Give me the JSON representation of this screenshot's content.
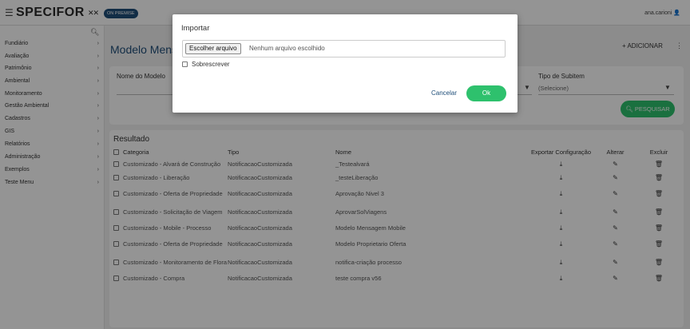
{
  "header": {
    "logo": "SPECIFOR",
    "logo_dots": "✕✕",
    "badge": "ON PREMISE",
    "user": "ana.carioni",
    "menu_icon": "hamburger-icon",
    "user_icon": "user-icon"
  },
  "sidebar": {
    "items": [
      {
        "label": "Fundiário"
      },
      {
        "label": "Avaliação"
      },
      {
        "label": "Patrimônio"
      },
      {
        "label": "Ambiental"
      },
      {
        "label": "Monitoramento"
      },
      {
        "label": "Gestão Ambiental"
      },
      {
        "label": "Cadastros"
      },
      {
        "label": "GIS"
      },
      {
        "label": "Relatórios"
      },
      {
        "label": "Administração"
      },
      {
        "label": "Exemplos"
      },
      {
        "label": "Teste Menu"
      }
    ]
  },
  "main": {
    "title": "Modelo Mensa",
    "add_label": "+ ADICIONAR",
    "filters": {
      "nome_label": "Nome do Modelo",
      "tipo_sub_label": "Tipo de Subitem",
      "tipo_sub_value": "(Selecione)",
      "search_label": "PESQUISAR"
    },
    "results": {
      "title": "Resultado",
      "headers": {
        "categoria": "Categoria",
        "tipo": "Tipo",
        "nome": "Nome",
        "exportar": "Exportar Configuração",
        "alterar": "Alterar",
        "excluir": "Excluir"
      },
      "rows": [
        {
          "categoria": "Customizado - Alvará de Construção",
          "tipo": "NotificacaoCustomizada",
          "nome": "_Testealvará"
        },
        {
          "categoria": "Customizado - Liberação",
          "tipo": "NotificacaoCustomizada",
          "nome": "_testeLiberação"
        },
        {
          "categoria": "Customizado - Oferta de Propriedade",
          "tipo": "NotificacaoCustomizada",
          "nome": "Aprovação Nivel 3"
        },
        {
          "categoria": "Customizado - Solicitação de Viagem",
          "tipo": "NotificacaoCustomizada",
          "nome": "AprovarSolViagens"
        },
        {
          "categoria": "Customizado - Mobile - Processo",
          "tipo": "NotificacaoCustomizada",
          "nome": "Modelo Mensagem Mobile"
        },
        {
          "categoria": "Customizado - Oferta de Propriedade",
          "tipo": "NotificacaoCustomizada",
          "nome": "Modelo Proprietario Oferta"
        },
        {
          "categoria": "Customizado - Monitoramento de Flora",
          "tipo": "NotificacaoCustomizada",
          "nome": "notifica-criação processo"
        },
        {
          "categoria": "Customizado - Compra",
          "tipo": "NotificacaoCustomizada",
          "nome": "teste compra v56"
        }
      ]
    }
  },
  "modal": {
    "title": "Importar",
    "file_button": "Escolher arquivo",
    "file_status": "Nenhum arquivo escolhido",
    "overwrite_label": "Sobrescrever",
    "cancel_label": "Cancelar",
    "ok_label": "Ok"
  },
  "colors": {
    "accent_green": "#2ec16d",
    "brand_blue": "#1f4e79"
  }
}
